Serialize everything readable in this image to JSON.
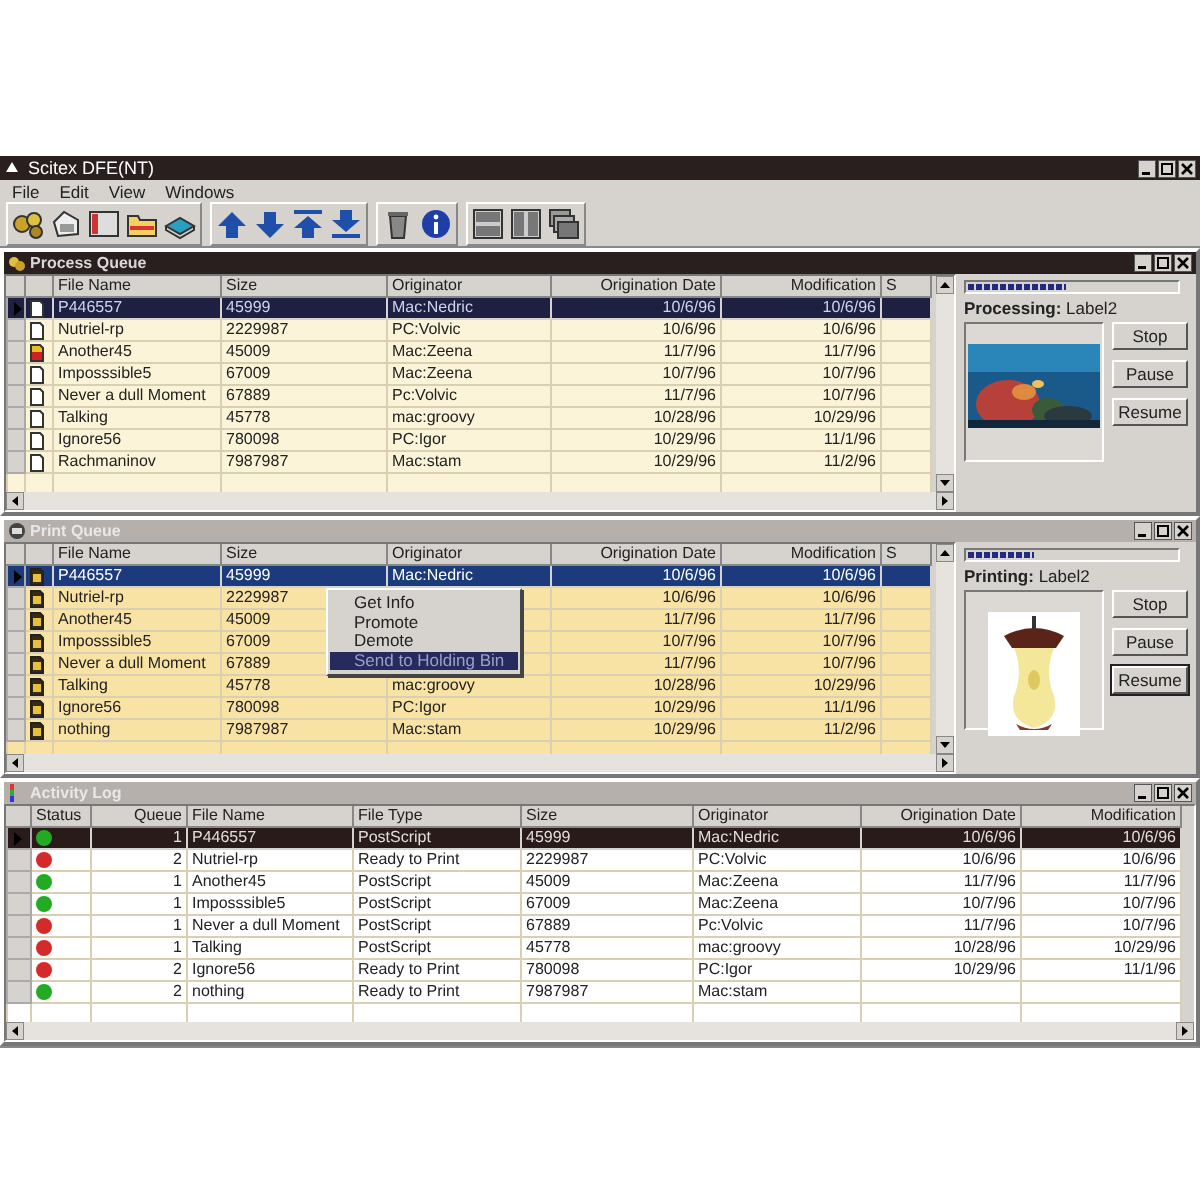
{
  "window": {
    "title": "Scitex DFE(NT)"
  },
  "menu": [
    "File",
    "Edit",
    "View",
    "Windows"
  ],
  "process_queue": {
    "title": "Process Queue",
    "active": true,
    "columns": [
      "File Name",
      "Size",
      "Originator",
      "Origination Date",
      "Modification",
      "S"
    ],
    "rows": [
      {
        "kind": "document",
        "selected": true,
        "cells": [
          "P446557",
          "45999",
          "Mac:Nedric",
          "10/6/96",
          "10/6/96"
        ]
      },
      {
        "kind": "document",
        "selected": false,
        "cells": [
          "Nutriel-rp",
          "2229987",
          "PC:Volvic",
          "10/6/96",
          "10/6/96"
        ]
      },
      {
        "kind": "marked-document",
        "selected": false,
        "cells": [
          "Another45",
          "45009",
          "Mac:Zeena",
          "11/7/96",
          "11/7/96"
        ]
      },
      {
        "kind": "document",
        "selected": false,
        "cells": [
          "Imposssible5",
          "67009",
          "Mac:Zeena",
          "10/7/96",
          "10/7/96"
        ]
      },
      {
        "kind": "document",
        "selected": false,
        "cells": [
          "Never a dull Moment",
          "67889",
          "Pc:Volvic",
          "11/7/96",
          "10/7/96"
        ]
      },
      {
        "kind": "document",
        "selected": false,
        "cells": [
          "Talking",
          "45778",
          "mac:groovy",
          "10/28/96",
          "10/29/96"
        ]
      },
      {
        "kind": "document",
        "selected": false,
        "cells": [
          "Ignore56",
          "780098",
          "PC:Igor",
          "10/29/96",
          "11/1/96"
        ]
      },
      {
        "kind": "document",
        "selected": false,
        "cells": [
          "Rachmaninov",
          "7987987",
          "Mac:stam",
          "10/29/96",
          "11/2/96"
        ]
      }
    ],
    "status": {
      "level": 0.47,
      "label": "**Processing:** Label2"
    },
    "preview": {
      "kind": "underwater"
    },
    "buttons": [
      {
        "label": "Stop",
        "default": false
      },
      {
        "label": "Pause",
        "default": false
      },
      {
        "label": "Resume",
        "default": false
      }
    ]
  },
  "print_queue": {
    "title": "Print Queue",
    "active": false,
    "columns": [
      "File Name",
      "Size",
      "Originator",
      "Origination Date",
      "Modification",
      "S"
    ],
    "rows": [
      {
        "kind": "print-document",
        "selected": true,
        "cells": [
          "P446557",
          "45999",
          "Mac:Nedric",
          "10/6/96",
          "10/6/96"
        ]
      },
      {
        "kind": "print-document",
        "selected": false,
        "cells": [
          "Nutriel-rp",
          "2229987",
          null,
          "10/6/96",
          "10/6/96"
        ]
      },
      {
        "kind": "print-document",
        "selected": false,
        "cells": [
          "Another45",
          "45009",
          null,
          "11/7/96",
          "11/7/96"
        ]
      },
      {
        "kind": "print-document",
        "selected": false,
        "cells": [
          "Imposssible5",
          "67009",
          null,
          "10/7/96",
          "10/7/96"
        ]
      },
      {
        "kind": "print-document",
        "selected": false,
        "cells": [
          "Never a dull Moment",
          "67889",
          null,
          "11/7/96",
          "10/7/96"
        ]
      },
      {
        "kind": "print-document",
        "selected": false,
        "cells": [
          "Talking",
          "45778",
          "mac:groovy",
          "10/28/96",
          "10/29/96"
        ]
      },
      {
        "kind": "print-document",
        "selected": false,
        "cells": [
          "Ignore56",
          "780098",
          "PC:Igor",
          "10/29/96",
          "11/1/96"
        ]
      },
      {
        "kind": "print-document",
        "selected": false,
        "cells": [
          "nothing",
          "7987987",
          "Mac:stam",
          "10/29/96",
          "11/2/96"
        ]
      }
    ],
    "context_menu": [
      {
        "label": "Get Info",
        "selected": false
      },
      {
        "label": "Promote",
        "selected": false
      },
      {
        "label": "Demote",
        "selected": false
      },
      {
        "label": "Send to Holding Bin",
        "selected": true
      }
    ],
    "status": {
      "level": 0.32,
      "label": "**Printing:** Label2"
    },
    "preview": {
      "kind": "apple-core"
    },
    "buttons": [
      {
        "label": "Stop",
        "default": false
      },
      {
        "label": "Pause",
        "default": false
      },
      {
        "label": "Resume",
        "default": true
      }
    ]
  },
  "activity_log": {
    "title": "Activity Log",
    "active": false,
    "columns": [
      "Status",
      "Queue",
      "File Name",
      "File Type",
      "Size",
      "Originator",
      "Origination Date",
      "Modification"
    ],
    "rows": [
      {
        "color": "#22aa22",
        "selected": true,
        "cells": [
          "",
          "1",
          "P446557",
          "PostScript",
          "45999",
          "Mac:Nedric",
          "10/6/96",
          "10/6/96"
        ]
      },
      {
        "color": "#d42a2a",
        "selected": false,
        "cells": [
          "",
          "2",
          "Nutriel-rp",
          "Ready to Print",
          "2229987",
          "PC:Volvic",
          "10/6/96",
          "10/6/96"
        ]
      },
      {
        "color": "#22aa22",
        "selected": false,
        "cells": [
          "",
          "1",
          "Another45",
          "PostScript",
          "45009",
          "Mac:Zeena",
          "11/7/96",
          "11/7/96"
        ]
      },
      {
        "color": "#22aa22",
        "selected": false,
        "cells": [
          "",
          "1",
          "Imposssible5",
          "PostScript",
          "67009",
          "Mac:Zeena",
          "10/7/96",
          "10/7/96"
        ]
      },
      {
        "color": "#d42a2a",
        "selected": false,
        "cells": [
          "",
          "1",
          "Never a dull Moment",
          "PostScript",
          "67889",
          "Pc:Volvic",
          "11/7/96",
          "10/7/96"
        ]
      },
      {
        "color": "#d42a2a",
        "selected": false,
        "cells": [
          "",
          "1",
          "Talking",
          "PostScript",
          "45778",
          "mac:groovy",
          "10/28/96",
          "10/29/96"
        ]
      },
      {
        "color": "#d42a2a",
        "selected": false,
        "cells": [
          "",
          "2",
          "Ignore56",
          "Ready to Print",
          "780098",
          "PC:Igor",
          "10/29/96",
          "11/1/96"
        ]
      },
      {
        "color": "#22aa22",
        "selected": false,
        "cells": [
          "",
          "2",
          "nothing",
          "Ready to Print",
          "7987987",
          "Mac:stam",
          null,
          null
        ]
      }
    ]
  }
}
